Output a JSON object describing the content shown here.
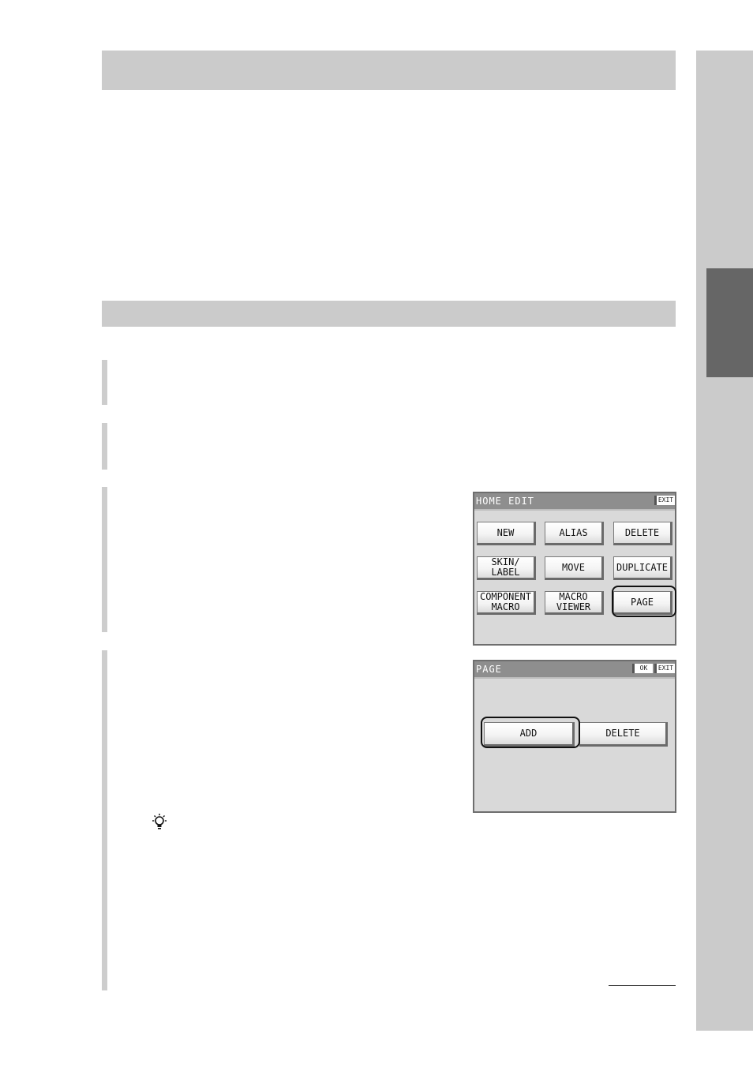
{
  "home_edit_screen": {
    "title": "HOME EDIT",
    "exit_label": "EXIT",
    "buttons": {
      "new": "NEW",
      "alias": "ALIAS",
      "delete": "DELETE",
      "skin_label": "SKIN/\nLABEL",
      "move": "MOVE",
      "duplicate": "DUPLICATE",
      "component_macro": "COMPONENT\nMACRO",
      "macro_viewer": "MACRO\nVIEWER",
      "page": "PAGE"
    },
    "highlighted": "PAGE"
  },
  "page_screen": {
    "title": "PAGE",
    "ok_label": "OK",
    "exit_label": "EXIT",
    "buttons": {
      "add": "ADD",
      "delete": "DELETE"
    },
    "highlighted": "ADD"
  },
  "icons": {
    "hint": "lightbulb-hint-icon"
  }
}
